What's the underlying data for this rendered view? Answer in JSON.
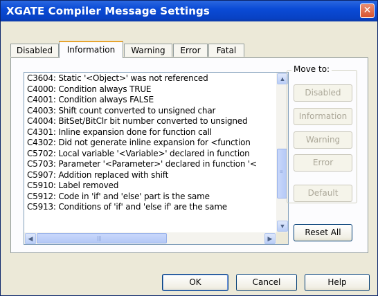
{
  "window": {
    "title": "XGATE Compiler Message Settings",
    "close_glyph": "✕"
  },
  "tabs": [
    {
      "label": "Disabled"
    },
    {
      "label": "Information"
    },
    {
      "label": "Warning"
    },
    {
      "label": "Error"
    },
    {
      "label": "Fatal"
    }
  ],
  "active_tab": "Information",
  "messages": [
    "C3604: Static '<Object>' was not referenced",
    "C4000: Condition always TRUE",
    "C4001: Condition always FALSE",
    "C4003: Shift count converted to unsigned char",
    "C4004: BitSet/BitClr bit number converted to unsigned",
    "C4301: Inline expansion done for function call",
    "C4302: Did not generate inline expansion for <function",
    "C5702: Local variable '<Variable>' declared in function",
    "C5703: Parameter '<Parameter>' declared in function '<",
    "C5907: Addition replaced with shift",
    "C5910: Label removed",
    "C5912: Code in 'if' and 'else' part is the same",
    "C5913: Conditions of 'if' and 'else if' are the same"
  ],
  "move_to": {
    "legend": "Move to:",
    "buttons": {
      "disabled": "Disabled",
      "information": "Information",
      "warning": "Warning",
      "error": "Error"
    },
    "default": "Default"
  },
  "reset_all": "Reset All",
  "footer": {
    "ok": "OK",
    "cancel": "Cancel",
    "help": "Help"
  },
  "scroll_glyphs": {
    "up": "▲",
    "down": "▼",
    "left": "◀",
    "right": "▶",
    "grip_v": "≡",
    "grip_h": "|||"
  }
}
